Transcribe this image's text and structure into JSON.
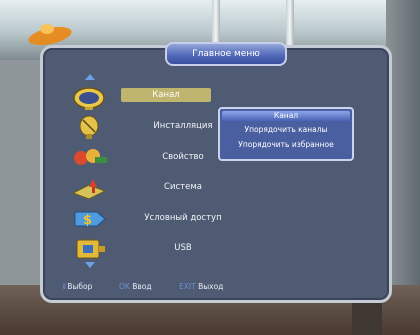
{
  "menu": {
    "title": "Главное меню",
    "items": [
      {
        "label": "Канал",
        "icon": "tv-icon",
        "active": true
      },
      {
        "label": "Инсталляция",
        "icon": "satellite-dish-icon"
      },
      {
        "label": "Свойство",
        "icon": "tools-icon"
      },
      {
        "label": "Система",
        "icon": "system-icon"
      },
      {
        "label": "Условный доступ",
        "icon": "card-access-icon"
      },
      {
        "label": "USB",
        "icon": "usb-icon"
      }
    ]
  },
  "submenu": {
    "title": "Канал",
    "items": [
      "Упорядочить каналы",
      "Упорядочить избранное"
    ]
  },
  "footer": {
    "select_key": "⇕",
    "select_label": "Выбор",
    "ok_key": "OK",
    "ok_label": "Ввод",
    "exit_key": "EXIT",
    "exit_label": "Выход"
  },
  "colors": {
    "panel": "#4e5b73",
    "highlight": "#bfb56f",
    "accent": "#6f8fd6"
  }
}
